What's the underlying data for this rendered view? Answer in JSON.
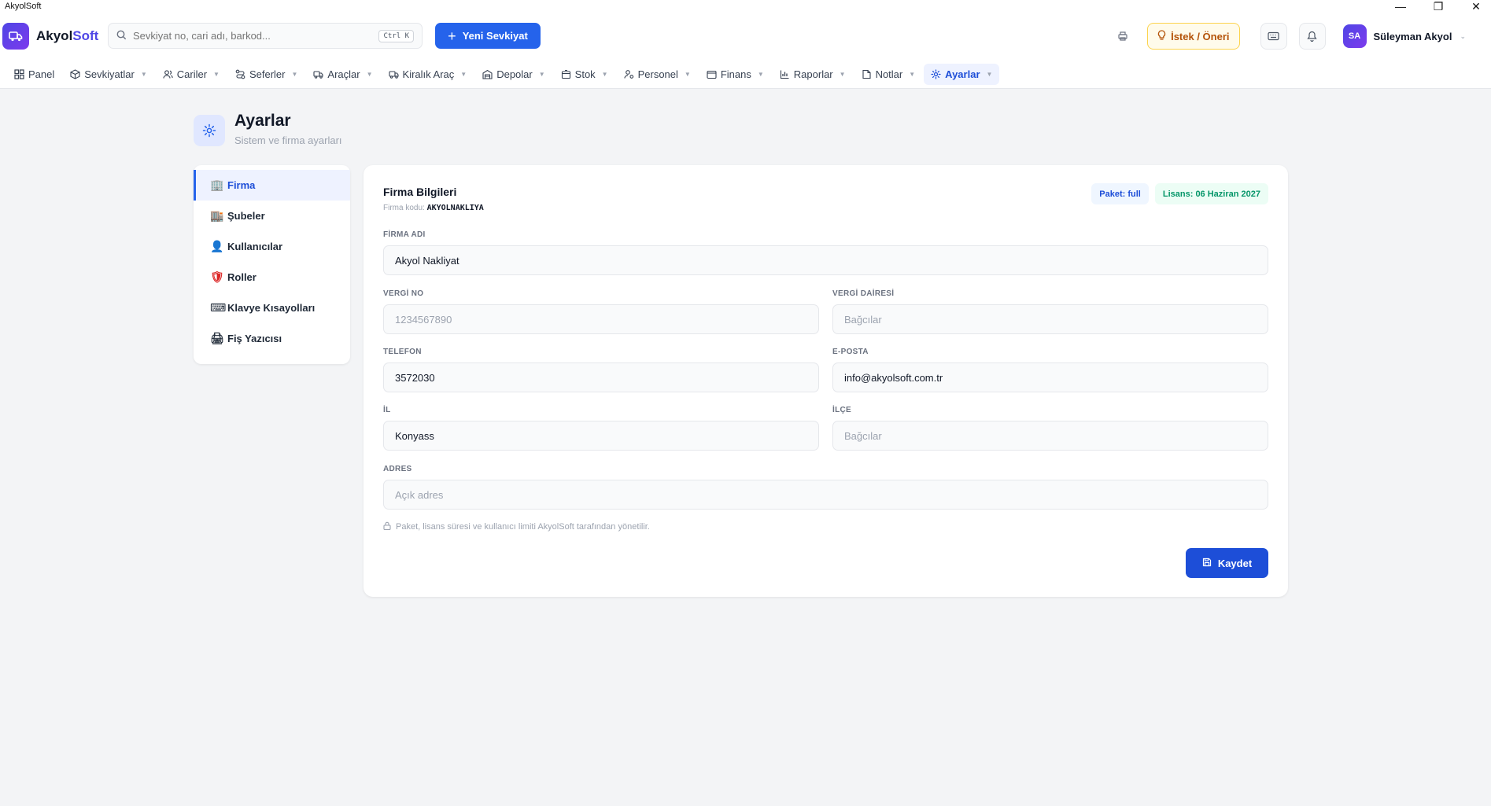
{
  "window": {
    "title": "AkyolSoft",
    "controls": [
      "—",
      "❐",
      "✕"
    ]
  },
  "header": {
    "brand_main": "Akyol",
    "brand_accent": "Soft",
    "search_placeholder": "Sevkiyat no, cari adı, barkod...",
    "search_shortcut": "Ctrl K",
    "new_button": "Yeni Sevkiyat",
    "suggest_button": "İstek / Öneri",
    "user_initials": "SA",
    "user_name": "Süleyman Akyol"
  },
  "nav": [
    {
      "label": "Panel",
      "icon": "grid-icon",
      "chevron": false,
      "active": false
    },
    {
      "label": "Sevkiyatlar",
      "icon": "box-icon",
      "chevron": true,
      "active": false
    },
    {
      "label": "Cariler",
      "icon": "users-icon",
      "chevron": true,
      "active": false
    },
    {
      "label": "Seferler",
      "icon": "route-icon",
      "chevron": true,
      "active": false
    },
    {
      "label": "Araçlar",
      "icon": "truck-icon",
      "chevron": true,
      "active": false
    },
    {
      "label": "Kiralık Araç",
      "icon": "truck-icon",
      "chevron": true,
      "active": false
    },
    {
      "label": "Depolar",
      "icon": "warehouse-icon",
      "chevron": true,
      "active": false
    },
    {
      "label": "Stok",
      "icon": "package-icon",
      "chevron": true,
      "active": false
    },
    {
      "label": "Personel",
      "icon": "user-gear-icon",
      "chevron": true,
      "active": false
    },
    {
      "label": "Finans",
      "icon": "wallet-icon",
      "chevron": true,
      "active": false
    },
    {
      "label": "Raporlar",
      "icon": "chart-icon",
      "chevron": true,
      "active": false
    },
    {
      "label": "Notlar",
      "icon": "note-icon",
      "chevron": true,
      "active": false
    },
    {
      "label": "Ayarlar",
      "icon": "gear-icon",
      "chevron": true,
      "active": true
    }
  ],
  "page": {
    "title": "Ayarlar",
    "subtitle": "Sistem ve firma ayarları"
  },
  "side_menu": [
    {
      "label": "Firma",
      "icon": "🏢",
      "active": true
    },
    {
      "label": "Şubeler",
      "icon": "🏬",
      "active": false
    },
    {
      "label": "Kullanıcılar",
      "icon": "👤",
      "active": false
    },
    {
      "label": "Roller",
      "icon": "🛡",
      "active": false
    },
    {
      "label": "Klavye Kısayolları",
      "icon": "⌨",
      "active": false
    },
    {
      "label": "Fiş Yazıcısı",
      "icon": "🖨",
      "active": false
    }
  ],
  "form": {
    "title": "Firma Bilgileri",
    "code_label": "Firma kodu:",
    "code_value": "AKYOLNAKLIYA",
    "badge_package": "Paket: full",
    "badge_license": "Lisans: 06 Haziran 2027",
    "firma_adi": {
      "label": "FİRMA ADI",
      "value": "Akyol Nakliyat",
      "placeholder": ""
    },
    "vergi_no": {
      "label": "VERGİ NO",
      "value": "",
      "placeholder": "1234567890"
    },
    "vergi_dairesi": {
      "label": "VERGİ DAİRESİ",
      "value": "",
      "placeholder": "Bağcılar"
    },
    "telefon": {
      "label": "TELEFON",
      "value": "3572030",
      "placeholder": ""
    },
    "eposta": {
      "label": "E-POSTA",
      "value": "info@akyolsoft.com.tr",
      "placeholder": ""
    },
    "il": {
      "label": "İL",
      "value": "Konyass",
      "placeholder": ""
    },
    "ilce": {
      "label": "İLÇE",
      "value": "",
      "placeholder": "Bağcılar"
    },
    "adres": {
      "label": "ADRES",
      "value": "",
      "placeholder": "Açık adres"
    },
    "note": "Paket, lisans süresi ve kullanıcı limiti AkyolSoft tarafından yönetilir.",
    "save_button": "Kaydet"
  },
  "colors": {
    "primary": "#2563eb",
    "brand": "#4f46e5",
    "background": "#f3f4f6"
  }
}
